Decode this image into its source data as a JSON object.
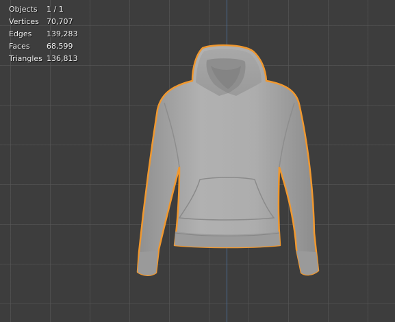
{
  "overlay": {
    "stats": [
      {
        "label": "Objects",
        "value": "1 / 1"
      },
      {
        "label": "Vertices",
        "value": "70,707"
      },
      {
        "label": "Edges",
        "value": "139,283"
      },
      {
        "label": "Faces",
        "value": "68,599"
      },
      {
        "label": "Triangles",
        "value": "136,813"
      }
    ]
  },
  "scene": {
    "object": "hoodie-mesh",
    "selected": true,
    "outline_color": "#f0982f",
    "mesh_color": "#a9a9a9",
    "background_color": "#3d3d3d",
    "grid_color": "#555555",
    "z_axis_color": "#4a6b94"
  }
}
